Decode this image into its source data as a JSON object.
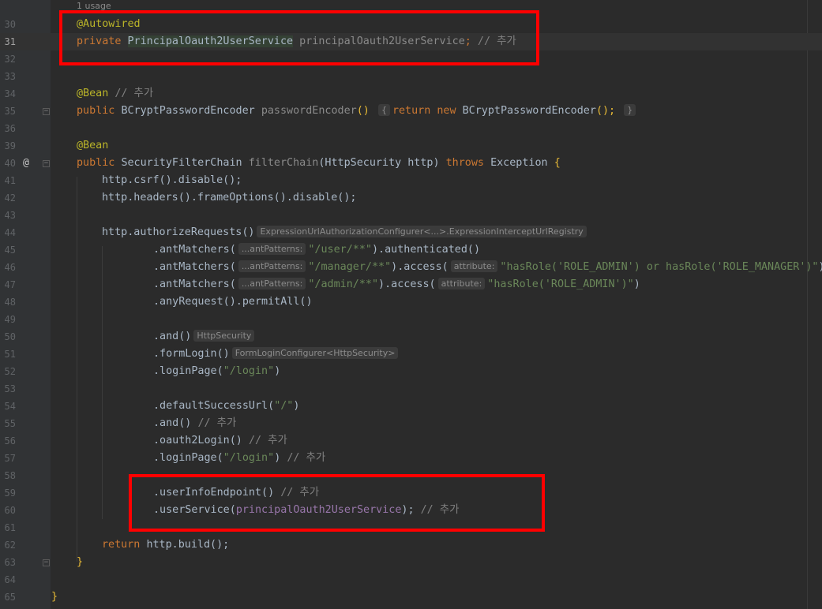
{
  "usage_hint": "1 usage",
  "line_numbers": [
    "30",
    "31",
    "32",
    "33",
    "34",
    "35",
    "36",
    "37",
    "38",
    "39",
    "40",
    "41",
    "42",
    "43",
    "44",
    "45",
    "46",
    "47",
    "48",
    "49",
    "50",
    "51",
    "52",
    "53",
    "54",
    "55",
    "56",
    "57",
    "58",
    "59",
    "60",
    "61",
    "62",
    "63",
    "64",
    "65"
  ],
  "code": {
    "l30_annotation": "@Autowired",
    "l31_private": "private",
    "l31_type": "PrincipalOauth2UserService",
    "l31_field": "principalOauth2UserService",
    "l31_semi": ";",
    "l31_comment": "// 추가",
    "l34_annotation": "@Bean",
    "l34_comment": "// 추가",
    "l35_public": "public",
    "l35_type": "BCryptPasswordEncoder",
    "l35_method": "passwordEncoder",
    "l35_parens": "()",
    "l35_brace_open": "{",
    "l35_return": "return",
    "l35_new": "new",
    "l35_ctor": "BCryptPasswordEncoder",
    "l35_ctor_parens": "();",
    "l35_brace_close": "}",
    "l39_annotation": "@Bean",
    "l40_public": "public",
    "l40_type": "SecurityFilterChain",
    "l40_method": "filterChain",
    "l40_params": "(HttpSecurity http)",
    "l40_throws": "throws",
    "l40_exception": "Exception",
    "l40_brace": "{",
    "l41_text": "http.csrf().disable();",
    "l42_text": "http.headers().frameOptions().disable();",
    "l44_text": "http.authorizeRequests()",
    "l44_hint": "ExpressionUrlAuthorizationConfigurer<...>.ExpressionInterceptUrlRegistry",
    "l45_call": ".antMatchers(",
    "l45_hint": "...antPatterns:",
    "l45_str": "\"/user/**\"",
    "l45_rest": ").authenticated()",
    "l46_call": ".antMatchers(",
    "l46_hint": "...antPatterns:",
    "l46_str": "\"/manager/**\"",
    "l46_mid": ").access(",
    "l46_hint2": "attribute:",
    "l46_str2": "\"hasRole('ROLE_ADMIN') or hasRole('ROLE_MANAGER')\"",
    "l46_end": ")",
    "l47_call": ".antMatchers(",
    "l47_hint": "...antPatterns:",
    "l47_str": "\"/admin/**\"",
    "l47_mid": ").access(",
    "l47_hint2": "attribute:",
    "l47_str2": "\"hasRole('ROLE_ADMIN')\"",
    "l47_end": ")",
    "l48_text": ".anyRequest().permitAll()",
    "l50_text": ".and()",
    "l50_hint": "HttpSecurity",
    "l51_text": ".formLogin()",
    "l51_hint": "FormLoginConfigurer<HttpSecurity>",
    "l52_call": ".loginPage(",
    "l52_str": "\"/login\"",
    "l52_end": ")",
    "l54_call": ".defaultSuccessUrl(",
    "l54_str": "\"/\"",
    "l54_end": ")",
    "l55_text": ".and()",
    "l55_comment": "// 추가",
    "l56_text": ".oauth2Login()",
    "l56_comment": "// 추가",
    "l57_call": ".loginPage(",
    "l57_str": "\"/login\"",
    "l57_end": ")",
    "l57_comment": "// 추가",
    "l59_text": ".userInfoEndpoint()",
    "l59_comment": "// 추가",
    "l60_call": ".userService(",
    "l60_field": "principalOauth2UserService",
    "l60_end": ");",
    "l60_comment": "// 추가",
    "l62_return": "return",
    "l62_text": "http.build();",
    "l63_brace": "}",
    "l65_brace": "}"
  },
  "gutter_icons": {
    "line40": "@"
  },
  "colors": {
    "background": "#2b2b2b",
    "keyword": "#cc7832",
    "annotation": "#bbb529",
    "method": "#ffc66d",
    "string": "#6a8759",
    "field": "#9876aa",
    "comment": "#808080",
    "highlight_box": "#ff0000"
  }
}
